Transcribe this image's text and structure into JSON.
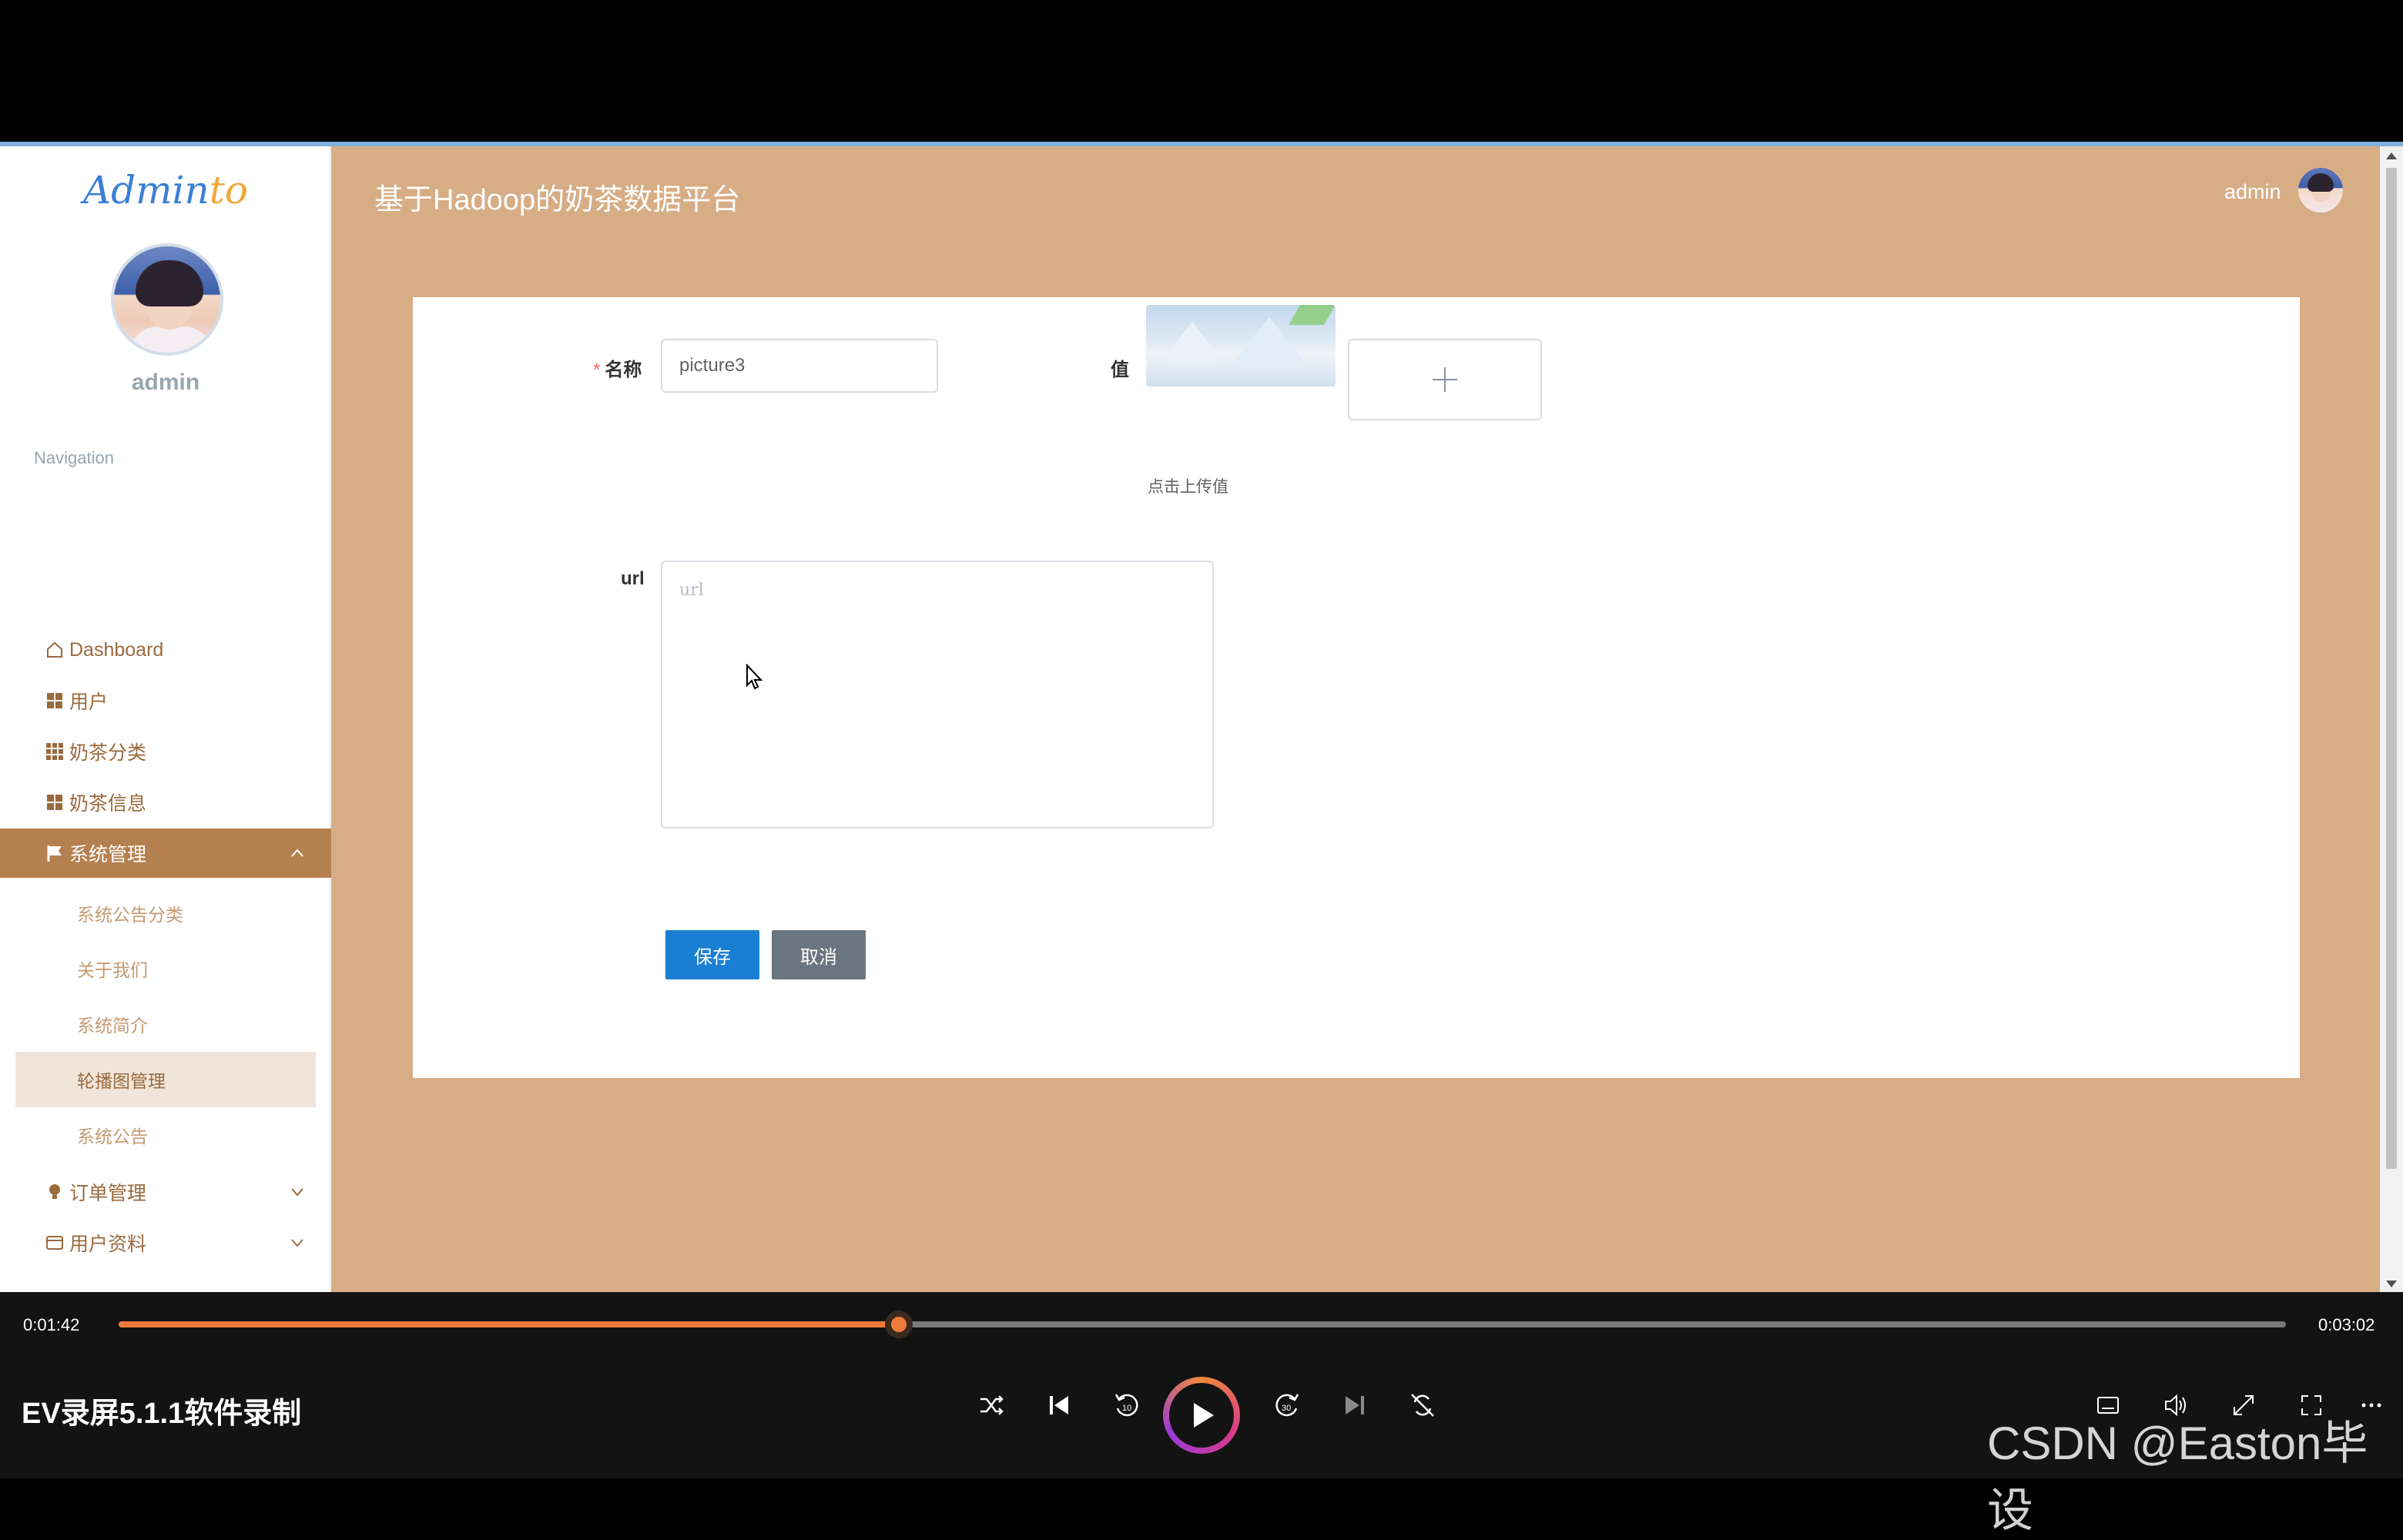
{
  "sidebar": {
    "logo_main": "Admin",
    "logo_accent": "to",
    "username": "admin",
    "nav_title": "Navigation",
    "items": [
      {
        "label": "Dashboard",
        "icon": "home-icon"
      },
      {
        "label": "用户",
        "icon": "grid-icon"
      },
      {
        "label": "奶茶分类",
        "icon": "apps-icon"
      },
      {
        "label": "奶茶信息",
        "icon": "grid-icon"
      },
      {
        "label": "系统管理",
        "icon": "flag-icon"
      },
      {
        "label": "订单管理",
        "icon": "bulb-icon"
      },
      {
        "label": "用户资料",
        "icon": "card-icon"
      }
    ],
    "sub_items": [
      "系统公告分类",
      "关于我们",
      "系统简介",
      "轮播图管理",
      "系统公告"
    ]
  },
  "header": {
    "title": "基于Hadoop的奶茶数据平台",
    "user": "admin"
  },
  "form": {
    "name_label": "名称",
    "name_required": "*",
    "name_value": "picture3",
    "value_label": "值",
    "upload_hint": "点击上传值",
    "url_label": "url",
    "url_placeholder": "url",
    "save_label": "保存",
    "cancel_label": "取消"
  },
  "player": {
    "current_time": "0:01:42",
    "total_time": "0:03:02",
    "progress_fraction": 0.36,
    "recorder_label": "EV录屏5.1.1软件录制",
    "accent_color": "#f07a3a"
  },
  "watermark": "CSDN @Easton毕设"
}
